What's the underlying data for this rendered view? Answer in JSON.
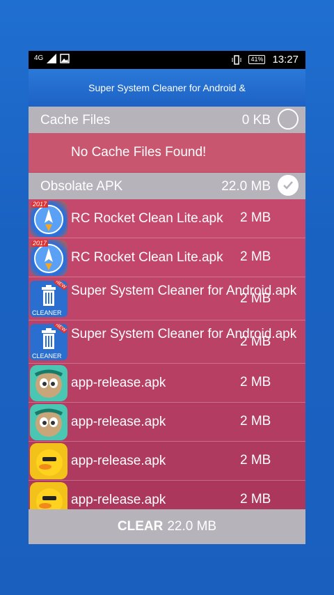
{
  "status_bar": {
    "network": "4G",
    "battery": "41%",
    "time": "13:27"
  },
  "app_title": "Super System Cleaner for Android &",
  "cache_section": {
    "title": "Cache Files",
    "size": "0 KB",
    "checked": false,
    "empty_message": "No Cache Files Found!"
  },
  "apk_section": {
    "title": "Obsolate APK",
    "size": "22.0 MB",
    "checked": true
  },
  "apk_items": [
    {
      "name": "RC Rocket Clean Lite.apk",
      "size": "2 MB",
      "icon": "rocket-clean-icon",
      "badge": "2017"
    },
    {
      "name": "RC Rocket Clean Lite.apk",
      "size": "2 MB",
      "icon": "rocket-clean-icon",
      "badge": "2017"
    },
    {
      "name": "Super System Cleaner for Android.apk",
      "size": "2 MB",
      "icon": "trash-cleaner-icon",
      "badge": "NEW",
      "label": "CLEANER"
    },
    {
      "name": "Super System Cleaner for Android.apk",
      "size": "2 MB",
      "icon": "trash-cleaner-icon",
      "badge": "NEW",
      "label": "CLEANER"
    },
    {
      "name": "app-release.apk",
      "size": "2 MB",
      "icon": "mascot-icon"
    },
    {
      "name": "app-release.apk",
      "size": "2 MB",
      "icon": "mascot-icon"
    },
    {
      "name": "app-release.apk",
      "size": "2 MB",
      "icon": "duck-icon"
    },
    {
      "name": "app-release.apk",
      "size": "2 MB",
      "icon": "duck-icon"
    }
  ],
  "clear_button": {
    "label": "CLEAR",
    "size": "22.0 MB"
  }
}
